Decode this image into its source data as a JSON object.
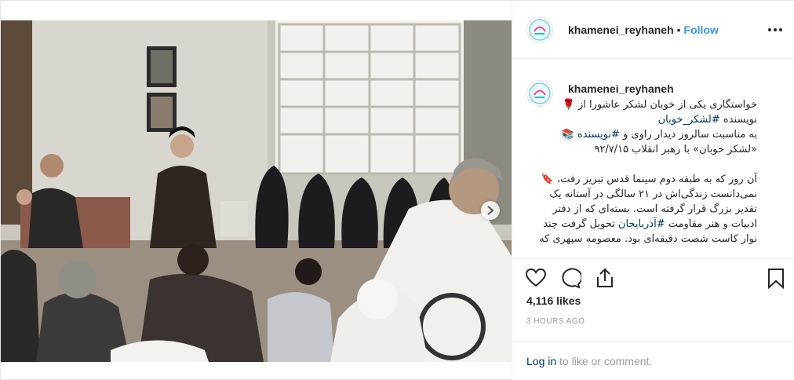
{
  "post": {
    "username": "khamenei_reyhaneh",
    "separator": "•",
    "follow_label": "Follow",
    "caption_lines": [
      "خواستگاری یکی از خوبان لشکر عاشورا از 🌹",
      "نویسنده #لشکر_خوبان",
      "به مناسبت سالروز دیدار راوی و #نویسنده 📚",
      "«لشکر خوبان» با رهبر انقلاب ۹۲/۷/۱۵",
      "",
      "آن روز که به طبقه دوم سینما قدس تبریز رفت، 🔖",
      "نمی‌دانست زندگی‌اش در ۲۱ سالگی در آستانه یک",
      "تقدیر بزرگ قرار گرفته است. بسته‌ای که از دفتر",
      "ادبیات و هنر مقاومت #آذربایجان تحویل گرفت چند",
      "نوار کاست شصت دقیقه‌ای بود. معصومه سپهری که"
    ],
    "likes": "4,116 likes",
    "time_ago": "3 HOURS AGO",
    "login_link": "Log in",
    "login_rest": " to like or comment.",
    "carousel": {
      "total": 4,
      "active": 0
    }
  },
  "colors": {
    "link_blue": "#3897f0",
    "hashtag": "#003569",
    "meta_gray": "#999999",
    "text": "#262626"
  },
  "icons": {
    "like": "heart-icon",
    "comment": "comment-icon",
    "share": "share-icon",
    "save": "bookmark-icon",
    "more": "more-dots-icon",
    "next": "chevron-right-icon"
  }
}
